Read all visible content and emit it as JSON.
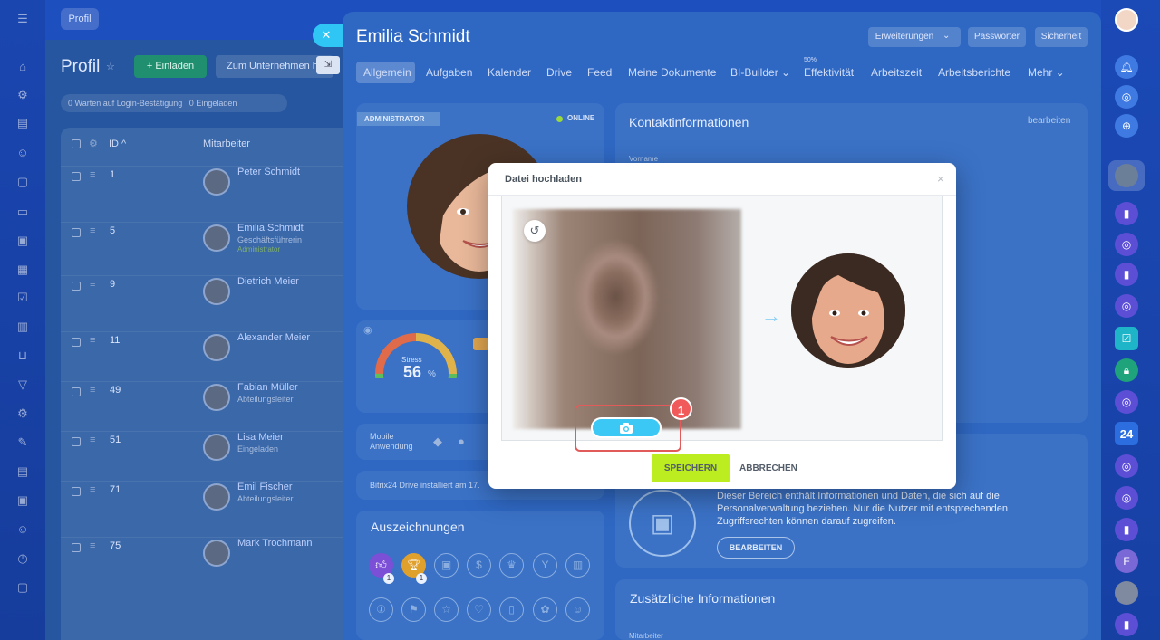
{
  "header_left": {
    "profile_btn": "Profil",
    "title": "Profil",
    "invite": "+ Einladen",
    "company": "Zum Unternehmen h"
  },
  "filters": {
    "waiting_count": "0",
    "waiting": "Warten auf Login-Bestätigung",
    "invited_count": "0",
    "invited": "Eingeladen"
  },
  "table": {
    "col_id": "ID ^",
    "col_employee": "Mitarbeiter",
    "rows": [
      {
        "id": "1",
        "name": "Peter Schmidt",
        "position": "",
        "role": ""
      },
      {
        "id": "5",
        "name": "Emilia Schmidt",
        "position": "Geschäftsführerin",
        "role": "Administrator"
      },
      {
        "id": "9",
        "name": "Dietrich Meier",
        "position": "",
        "role": ""
      },
      {
        "id": "11",
        "name": "Alexander Meier",
        "position": "",
        "role": ""
      },
      {
        "id": "49",
        "name": "Fabian Müller",
        "position": "Abteilungsleiter",
        "role": ""
      },
      {
        "id": "51",
        "name": "Lisa Meier",
        "position": "Eingeladen",
        "role": ""
      },
      {
        "id": "71",
        "name": "Emil Fischer",
        "position": "Abteilungsleiter",
        "role": ""
      },
      {
        "id": "75",
        "name": "Mark Trochmann",
        "position": "",
        "role": ""
      }
    ]
  },
  "slider": {
    "title": "Emilia Schmidt",
    "buttons": [
      "Erweiterungen",
      "Passwörter",
      "Sicherheit"
    ],
    "tabs": [
      "Allgemein",
      "Aufgaben",
      "Kalender",
      "Drive",
      "Feed",
      "Meine Dokumente",
      "BI-Builder ⌄",
      "Effektivität",
      "Arbeitszeit",
      "Arbeitsberichte",
      "Mehr ⌄"
    ],
    "effectivity_pct": "50%",
    "admin_badge": "ADMINISTRATOR",
    "online": "ONLINE",
    "stress_label": "Stress",
    "stress_value": "56",
    "stress_unit": "%",
    "mobile": "Mobile Anwendung",
    "drive": "Bitrix24 Drive installiert am 17.",
    "awards": "Auszeichnungen",
    "contact_title": "Kontaktinformationen",
    "edit": "bearbeiten",
    "firstname": "Vorname",
    "hr_text": "Dieser Bereich enthält Informationen und Daten, die sich auf die Personalverwaltung beziehen. Nur die Nutzer mit entsprechenden Zugriffsrechten können darauf zugreifen.",
    "hr_edit": "BEARBEITEN",
    "extra_title": "Zusätzliche Informationen",
    "employee": "Mitarbeiter",
    "award_counts": [
      "1",
      "1"
    ]
  },
  "right_rail": {
    "counter": "24"
  },
  "dialog": {
    "title": "Datei hochladen",
    "close": "×",
    "save": "SPEICHERN",
    "cancel": "ABBRECHEN",
    "step": "1"
  },
  "colors": {
    "accent": "#3bc8f5",
    "save": "#bbed21",
    "highlight": "#e25b5b"
  },
  "icons": [
    "menu-icon",
    "camera-icon",
    "undo-icon",
    "arrow-right-icon",
    "close-icon",
    "bell-icon"
  ]
}
